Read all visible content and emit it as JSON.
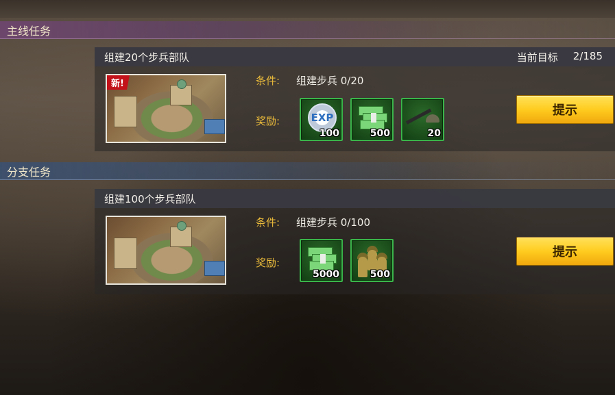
{
  "sections": {
    "main": {
      "title": "主线任务"
    },
    "branch": {
      "title": "分支任务"
    }
  },
  "main_quest": {
    "title": "组建20个步兵部队",
    "progress_label": "当前目标",
    "progress_value": "2/185",
    "new_badge": "新!",
    "condition_label": "条件:",
    "condition_value": "组建步兵 0/20",
    "reward_label": "奖励:",
    "rewards": [
      {
        "icon": "exp-icon",
        "amount": "100"
      },
      {
        "icon": "cash-icon",
        "amount": "500"
      },
      {
        "icon": "rifle-icon",
        "amount": "20"
      }
    ],
    "hint_button": "提示"
  },
  "branch_quest": {
    "title": "组建100个步兵部队",
    "condition_label": "条件:",
    "condition_value": "组建步兵 0/100",
    "reward_label": "奖励:",
    "rewards": [
      {
        "icon": "cash-icon",
        "amount": "5000"
      },
      {
        "icon": "soldiers-icon",
        "amount": "500"
      }
    ],
    "hint_button": "提示"
  },
  "colors": {
    "accent_label": "#e8b93a",
    "button": "#ffcc1f",
    "reward_border": "#39b54a",
    "new_badge": "#c4121b"
  }
}
